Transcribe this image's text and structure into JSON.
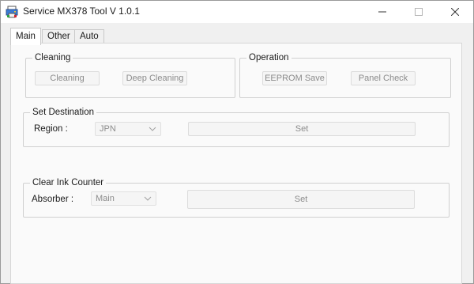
{
  "window": {
    "title": "Service MX378 Tool V 1.0.1"
  },
  "tabs": [
    {
      "label": "Main",
      "active": true
    },
    {
      "label": "Other",
      "active": false
    },
    {
      "label": "Auto",
      "active": false
    }
  ],
  "cleaning": {
    "legend": "Cleaning",
    "cleaning_label": "Cleaning",
    "deep_cleaning_label": "Deep Cleaning"
  },
  "operation": {
    "legend": "Operation",
    "eeprom_label": "EEPROM Save",
    "panel_check_label": "Panel Check"
  },
  "destination": {
    "legend": "Set Destination",
    "region_label": "Region :",
    "region_value": "JPN",
    "set_label": "Set"
  },
  "ink_counter": {
    "legend": "Clear Ink Counter",
    "absorber_label": "Absorber :",
    "absorber_value": "Main",
    "set_label": "Set"
  },
  "colors": {
    "disabled_text": "#8c8c8c",
    "panel_bg": "#fafafa",
    "window_bg": "#f0f0f0"
  },
  "icons": {
    "app": "printer-app-icon",
    "minimize": "minimize-icon",
    "maximize": "maximize-icon",
    "close": "close-icon"
  }
}
